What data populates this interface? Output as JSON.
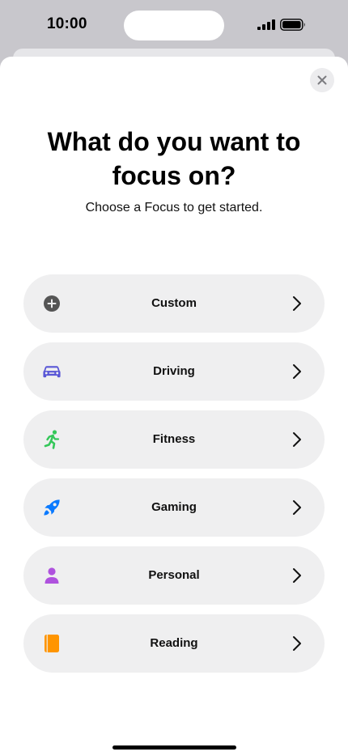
{
  "status_bar": {
    "time": "10:00"
  },
  "sheet": {
    "close_icon": "xmark-icon",
    "title": "What do you want to focus on?",
    "subtitle": "Choose a Focus to get started."
  },
  "focus_options": [
    {
      "label": "Custom",
      "icon": "plus-circle-icon",
      "color": "#555555"
    },
    {
      "label": "Driving",
      "icon": "car-icon",
      "color": "#5856d6"
    },
    {
      "label": "Fitness",
      "icon": "running-icon",
      "color": "#34c759"
    },
    {
      "label": "Gaming",
      "icon": "rocket-icon",
      "color": "#0a7aff"
    },
    {
      "label": "Personal",
      "icon": "person-icon",
      "color": "#af52de"
    },
    {
      "label": "Reading",
      "icon": "book-icon",
      "color": "#ff9500"
    }
  ]
}
